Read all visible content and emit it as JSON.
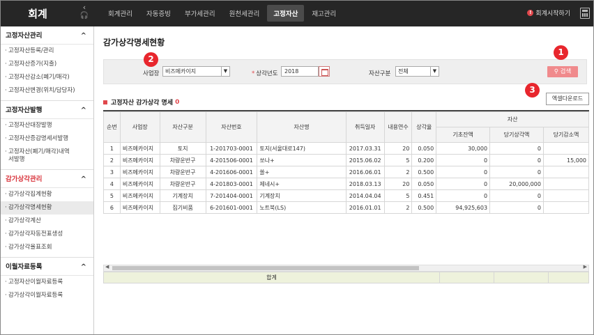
{
  "brand": "회계",
  "nav": [
    "회계관리",
    "자동증빙",
    "부가세관리",
    "원천세관리",
    "고정자산",
    "재고관리"
  ],
  "nav_active_index": 4,
  "header_right": {
    "start_label": "회계시작하기"
  },
  "sidebar": [
    {
      "title": "고정자산관리",
      "highlight": false,
      "items": [
        "고정자산등록/관리",
        "고정자산증가(지출)",
        "고정자산감소(폐기/매각)",
        "고정자산변경(위치/담당자)"
      ]
    },
    {
      "title": "고정자산발행",
      "highlight": false,
      "items": [
        "고정자산대장발행",
        "고정자산증감명세서발행",
        "고정자산(폐기/매각)내역서발행"
      ]
    },
    {
      "title": "감가상각관리",
      "highlight": true,
      "items": [
        "감가상각집계현황",
        "감가상각명세현황",
        "감가상각계산",
        "감가상각자동전표생성",
        "감가상각율표조회"
      ]
    },
    {
      "title": "이월자료등록",
      "highlight": false,
      "items": [
        "고정자산이월자료등록",
        "감가상각이월자료등록"
      ]
    }
  ],
  "sidebar_selected": "감가상각명세현황",
  "page_title": "감가상각명세현황",
  "filters": {
    "business_label": "사업장",
    "business_value": "비즈메카이지",
    "year_label": "상각년도",
    "year_value": "2018",
    "asset_type_label": "자산구분",
    "asset_type_value": "전체"
  },
  "search_label": "검색",
  "excel_label": "엑셀다운로드",
  "badges": [
    "1",
    "2",
    "3"
  ],
  "list_title": "고정자산 감가상각 명세",
  "list_count": "0",
  "table": {
    "group_header": "자산",
    "columns": [
      "순번",
      "사업장",
      "자산구분",
      "자산번호",
      "자산명",
      "취득일자",
      "내용연수",
      "상각율"
    ],
    "sub_columns": [
      "기초잔액",
      "당기상각액",
      "당기감소액"
    ],
    "rows": [
      [
        "1",
        "비즈메카이지",
        "토지",
        "1-201703-0001",
        "토지(서울대로147)",
        "2017.03.31",
        "20",
        "0.050",
        "30,000",
        "0",
        ""
      ],
      [
        "2",
        "비즈메카이지",
        "차량운반구",
        "4-201506-0001",
        "쏘나+",
        "2015.06.02",
        "5",
        "0.200",
        "0",
        "0",
        "15,000"
      ],
      [
        "3",
        "비즈메카이지",
        "차량운반구",
        "4-201606-0001",
        "쏠+",
        "2016.06.01",
        "2",
        "0.500",
        "0",
        "0",
        ""
      ],
      [
        "4",
        "비즈메카이지",
        "차량운반구",
        "4-201803-0001",
        "제네시+",
        "2018.03.13",
        "20",
        "0.050",
        "0",
        "20,000,000",
        ""
      ],
      [
        "5",
        "비즈메카이지",
        "기계장치",
        "7-201404-0001",
        "기계장치",
        "2014.04.04",
        "5",
        "0.451",
        "0",
        "0",
        ""
      ],
      [
        "6",
        "비즈메카이지",
        "집기비품",
        "6-201601-0001",
        "노트북(LS)",
        "2016.01.01",
        "2",
        "0.500",
        "94,925,603",
        "0",
        ""
      ]
    ]
  },
  "total_label": "합계"
}
